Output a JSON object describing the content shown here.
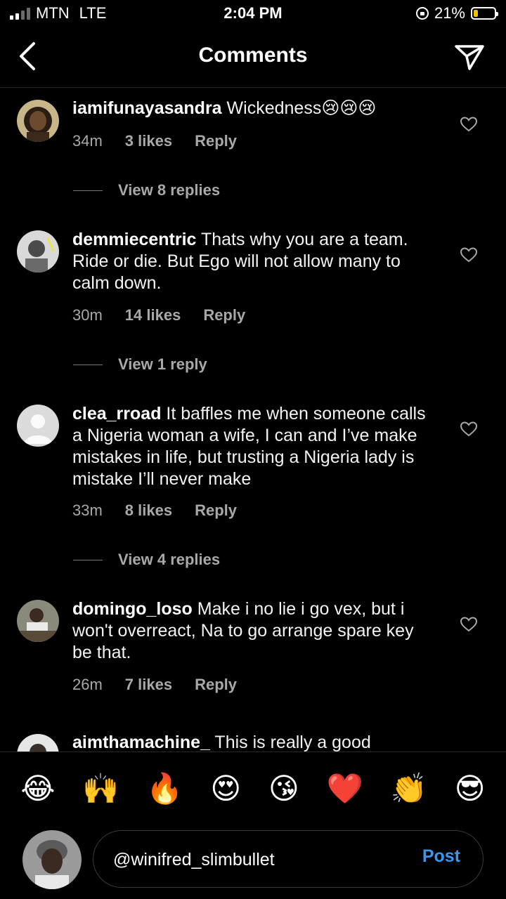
{
  "status_bar": {
    "carrier": "MTN",
    "network": "LTE",
    "time": "2:04 PM",
    "battery": "21%",
    "battery_level": 0.21
  },
  "header": {
    "title": "Comments"
  },
  "comments": [
    {
      "username": "iamifunayasandra",
      "text": "Wickedness😢😢😢",
      "time": "34m",
      "likes": "3 likes",
      "reply": "Reply",
      "view_replies": "View 8 replies"
    },
    {
      "username": "demmiecentric",
      "text": "Thats why you are a team. Ride or die. But Ego will not allow many to calm down.",
      "time": "30m",
      "likes": "14 likes",
      "reply": "Reply",
      "view_replies": "View 1 reply"
    },
    {
      "username": "clea_rroad",
      "text": "It baffles me when someone calls a Nigeria woman a wife, I can and I’ve make mistakes in life, but trusting a Nigeria lady is mistake I’ll never make",
      "time": "33m",
      "likes": "8 likes",
      "reply": "Reply",
      "view_replies": "View 4 replies"
    },
    {
      "username": "domingo_loso",
      "text": "Make i no lie i go vex, but i won't overreact, Na to go arrange spare key be that.",
      "time": "26m",
      "likes": "7 likes",
      "reply": "Reply"
    },
    {
      "username": "aimthamachine_",
      "text": "This is really a good"
    }
  ],
  "emoji_bar": [
    "😂",
    "🙌",
    "🔥",
    "😍",
    "😘",
    "❤️",
    "👏",
    "😎"
  ],
  "composer": {
    "value": "@winifred_slimbullet",
    "post_label": "Post"
  }
}
